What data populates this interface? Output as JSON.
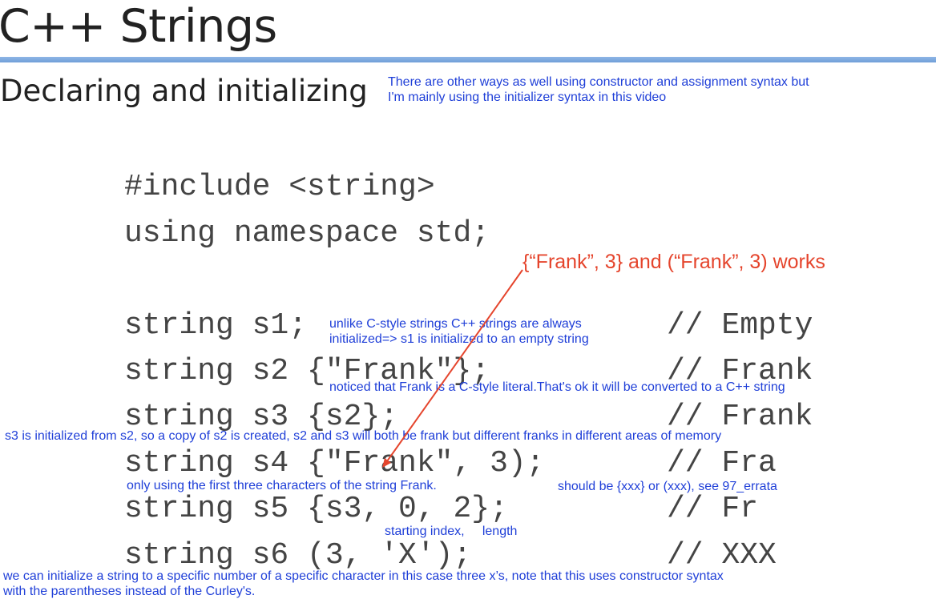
{
  "slide": {
    "title": "C++ Strings",
    "subtitle": "Declaring and initializing"
  },
  "notes": {
    "intro_line1": "There are other ways as well using constructor and assignment syntax but",
    "intro_line2": "I'm mainly using the initializer syntax in this video",
    "s1_line1": "unlike C-style strings C++ strings are always",
    "s1_line2": "initialized=> s1 is initialized to an empty string",
    "s2": "noticed that Frank is a C-style literal.That's ok it will be converted to a C++ string",
    "s3": "s3 is initialized from s2, so a copy of s2 is created, s2 and s3 will both be frank but different franks in different areas of memory",
    "s4": "only using the first three characters of the string Frank.",
    "errata": "should be {xxx} or (xxx), see 97_errata",
    "s5": "starting index,     length",
    "s6_line1": "we can initialize a string to a specific number of a specific character in this case three x’s, note that this uses constructor syntax",
    "s6_line2": "with the parentheses instead of the Curley's.",
    "works": "{“Frank”, 3} and (“Frank”, 3) works"
  },
  "code": {
    "include": "#include <string>",
    "using": "using namespace std;",
    "l1": "string s1;",
    "c1": "// Empty",
    "l2": "string s2 {\"Frank\"};",
    "c2": "// Frank",
    "l3": "string s3 {s2};",
    "c3": "// Frank",
    "l4": "string s4 {\"Frank\", 3);",
    "c4": "// Fra",
    "l5": "string s5 {s3, 0, 2};",
    "c5": "// Fr",
    "l6": "string s6 (3, 'X');",
    "c6": "// XXX"
  },
  "colors": {
    "annotation_blue": "#1f3fd8",
    "annotation_red": "#e5452d",
    "code_gray": "#444444",
    "rule_blue": "#7aa7dd"
  }
}
